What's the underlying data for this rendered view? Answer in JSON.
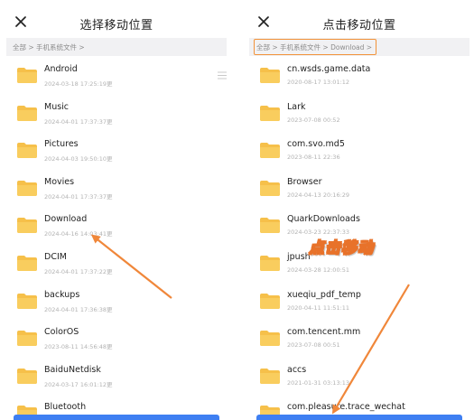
{
  "left_panel": {
    "title": "选择移动位置",
    "breadcrumb": "全部 > 手机系统文件 >",
    "items": [
      {
        "name": "Android",
        "date": "2024-03-18 17:25:19更"
      },
      {
        "name": "Music",
        "date": "2024-04-01 17:37:37更"
      },
      {
        "name": "Pictures",
        "date": "2024-04-03 19:50:10更"
      },
      {
        "name": "Movies",
        "date": "2024-04-01 17:37:37更"
      },
      {
        "name": "Download",
        "date": "2024-04-16 14:03:41更"
      },
      {
        "name": "DCIM",
        "date": "2024-04-01 17:37:22更"
      },
      {
        "name": "backups",
        "date": "2024-04-01 17:36:38更"
      },
      {
        "name": "ColorOS",
        "date": "2023-08-11 14:56:48更"
      },
      {
        "name": "BaiduNetdisk",
        "date": "2024-03-17 16:01:12更"
      },
      {
        "name": "Bluetooth",
        "date": ""
      }
    ]
  },
  "right_panel": {
    "title": "点击移动位置",
    "breadcrumb": "全部 > 手机系统文件 > Download >",
    "items": [
      {
        "name": "cn.wsds.game.data",
        "date": "2020-08-17 13:01:12"
      },
      {
        "name": "Lark",
        "date": "2023-07-08 00:52"
      },
      {
        "name": "com.svo.md5",
        "date": "2023-08-11 22:36"
      },
      {
        "name": "Browser",
        "date": "2024-04-13 20:16:29"
      },
      {
        "name": "QuarkDownloads",
        "date": "2024-03-23 22:37:33"
      },
      {
        "name": "jpush",
        "date": "2024-03-28 12:00:51"
      },
      {
        "name": "xueqiu_pdf_temp",
        "date": "2020-04-11 11:51:11"
      },
      {
        "name": "com.tencent.mm",
        "date": "2023-07-08 00:51"
      },
      {
        "name": "accs",
        "date": "2021-01-31 03:13:13"
      },
      {
        "name": "com.pleasure.trace_wechat",
        "date": ""
      }
    ]
  },
  "annotation": "点击移动",
  "colors": {
    "accent": "#f2933a",
    "folder": "#f6c04a",
    "button": "#3e7ff2"
  }
}
